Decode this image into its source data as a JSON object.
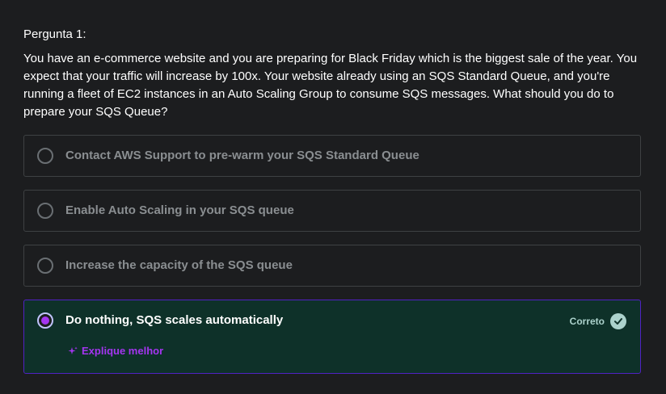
{
  "question": {
    "label": "Pergunta 1:",
    "text": "You have an e-commerce website and you are preparing for Black Friday which is the biggest sale of the year. You expect that your traffic will increase by 100x. Your website already using an SQS Standard Queue, and you're running a fleet of EC2 instances in an Auto Scaling Group to consume SQS messages. What should you do to prepare your SQS Queue?"
  },
  "options": [
    {
      "label": "Contact AWS Support to pre-warm your SQS Standard Queue",
      "selected": false
    },
    {
      "label": "Enable Auto Scaling in your SQS queue",
      "selected": false
    },
    {
      "label": "Increase the capacity of the SQS queue",
      "selected": false
    },
    {
      "label": "Do nothing, SQS scales automatically",
      "selected": true
    }
  ],
  "feedback": {
    "status_text": "Correto",
    "explain_label": "Explique melhor"
  },
  "colors": {
    "background": "#1c1d1f",
    "correct_bg": "#0e3129",
    "correct_border": "#5022c3",
    "correct_text": "#acd2cc",
    "accent_purple": "#a435f0",
    "muted_text": "#8a8e91"
  },
  "icons": {
    "check": "check-circle-icon",
    "sparkle": "sparkle-icon"
  }
}
